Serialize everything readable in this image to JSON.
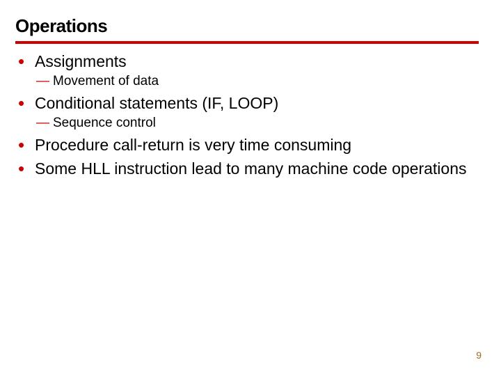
{
  "slide": {
    "title": "Operations",
    "bullets": [
      {
        "text": "Assignments",
        "subs": [
          "Movement of data"
        ]
      },
      {
        "text": "Conditional statements (IF, LOOP)",
        "subs": [
          "Sequence control"
        ]
      },
      {
        "text": "Procedure call-return is very time consuming",
        "subs": []
      },
      {
        "text": "Some HLL instruction lead to many machine code operations",
        "subs": []
      }
    ],
    "page_number": "9"
  }
}
